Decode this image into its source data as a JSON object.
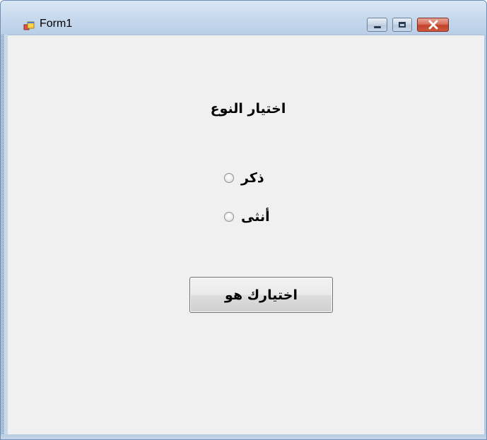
{
  "window": {
    "title": "Form1",
    "controls": {
      "minimize": "minimize-icon",
      "maximize": "maximize-icon",
      "close": "close-icon"
    }
  },
  "form": {
    "heading": "اختيار النوع",
    "options": [
      {
        "label": "ذكر",
        "checked": false
      },
      {
        "label": "أنثى",
        "checked": false
      }
    ],
    "button_label": "اختيارك هو"
  },
  "colors": {
    "client_background": "#f0f0f0",
    "title_bar": "#c7d9ed",
    "close_button": "#c0412a"
  }
}
